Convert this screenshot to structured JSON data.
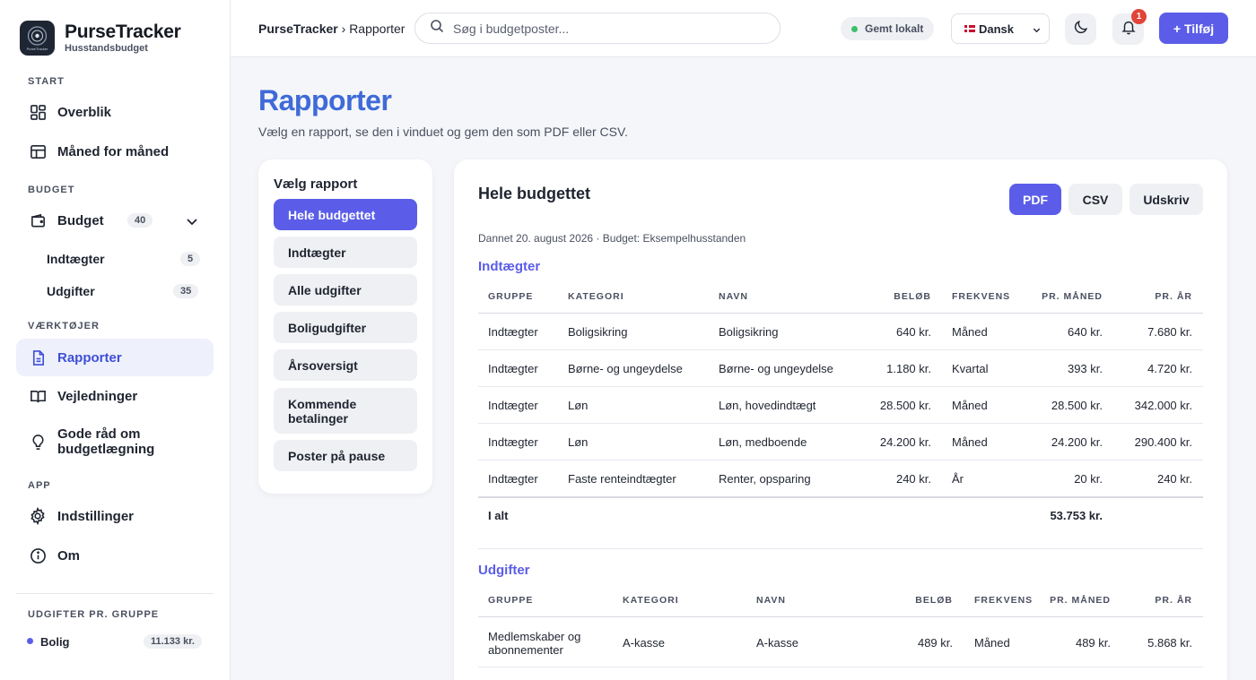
{
  "app": {
    "name": "PurseTracker",
    "subtitle": "Husstandsbudget",
    "logo_text": "PurseTracker"
  },
  "sidebar": {
    "sections": {
      "start": "START",
      "budget": "BUDGET",
      "tools": "VÆRKTØJER",
      "app": "APP",
      "groups": "UDGIFTER PR. GRUPPE"
    },
    "items": {
      "overview": "Overblik",
      "monthly": "Måned for måned",
      "budget": "Budget",
      "budget_count": "40",
      "income": "Indtægter",
      "income_count": "5",
      "expenses": "Udgifter",
      "expenses_count": "35",
      "reports": "Rapporter",
      "guides": "Vejledninger",
      "tips": "Gode råd om budgetlægning",
      "settings": "Indstillinger",
      "about": "Om"
    },
    "groups": [
      {
        "name": "Bolig",
        "amount": "11.133 kr.",
        "color": "#5b5de8"
      }
    ]
  },
  "header": {
    "breadcrumb_root": "PurseTracker",
    "breadcrumb_sep": " › ",
    "breadcrumb_page": "Rapporter",
    "search_placeholder": "Søg i budgetposter...",
    "saved_status": "Gemt lokalt",
    "language": "Dansk",
    "notifications_count": "1",
    "add_label": "+ Tilføj"
  },
  "main": {
    "title": "Rapporter",
    "subtitle": "Vælg en rapport, se den i vinduet og gem den som PDF eller CSV.",
    "picker": {
      "title": "Vælg rapport",
      "options": [
        "Hele budgettet",
        "Indtægter",
        "Alle udgifter",
        "Boligudgifter",
        "Årsoversigt",
        "Kommende betalinger",
        "Poster på pause"
      ]
    },
    "report": {
      "title": "Hele budgettet",
      "buttons": {
        "pdf": "PDF",
        "csv": "CSV",
        "print": "Udskriv"
      },
      "meta": "Dannet 20. august 2026 · Budget: Eksempelhusstanden",
      "columns": [
        "GRUPPE",
        "KATEGORI",
        "NAVN",
        "BELØB",
        "FREKVENS",
        "PR. MÅNED",
        "PR. ÅR"
      ],
      "income": {
        "heading": "Indtægter",
        "rows": [
          [
            "Indtægter",
            "Boligsikring",
            "Boligsikring",
            "640 kr.",
            "Måned",
            "640 kr.",
            "7.680 kr."
          ],
          [
            "Indtægter",
            "Børne- og ungeydelse",
            "Børne- og ungeydelse",
            "1.180 kr.",
            "Kvartal",
            "393 kr.",
            "4.720 kr."
          ],
          [
            "Indtægter",
            "Løn",
            "Løn, hovedindtægt",
            "28.500 kr.",
            "Måned",
            "28.500 kr.",
            "342.000 kr."
          ],
          [
            "Indtægter",
            "Løn",
            "Løn, medboende",
            "24.200 kr.",
            "Måned",
            "24.200 kr.",
            "290.400 kr."
          ],
          [
            "Indtægter",
            "Faste renteindtægter",
            "Renter, opsparing",
            "240 kr.",
            "År",
            "20 kr.",
            "240 kr."
          ]
        ],
        "total_label": "I alt",
        "total_month": "53.753 kr."
      },
      "expenses": {
        "heading": "Udgifter",
        "rows": [
          [
            "Medlemskaber og abonnementer",
            "A-kasse",
            "A-kasse",
            "489 kr.",
            "Måned",
            "489 kr.",
            "5.868 kr."
          ]
        ]
      }
    }
  }
}
